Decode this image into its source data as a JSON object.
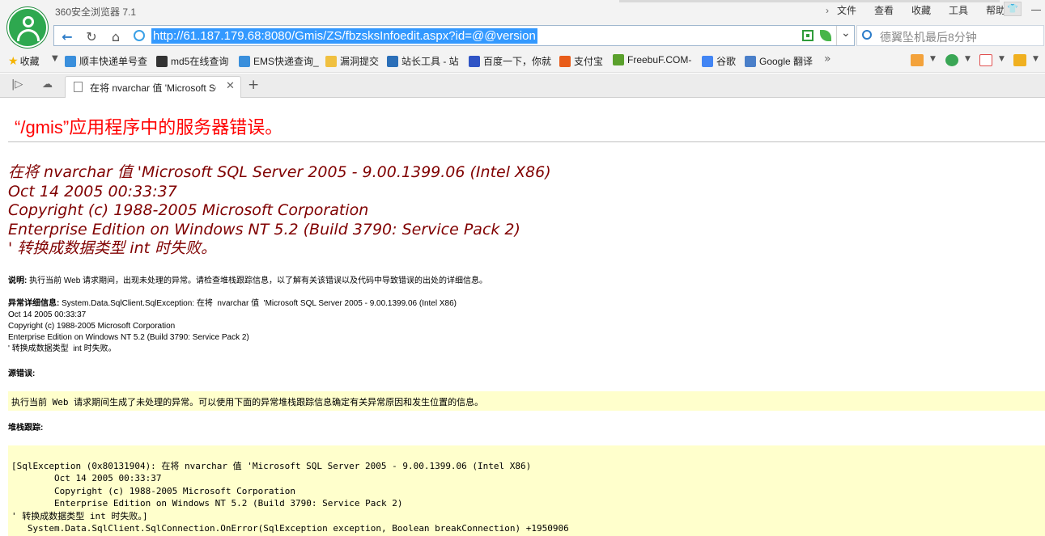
{
  "window": {
    "title": "360安全浏览器 7.1",
    "menus": [
      "文件",
      "查看",
      "收藏",
      "工具",
      "帮助"
    ],
    "skin_label": "👕"
  },
  "nav": {
    "url": "http://61.187.179.68:8080/Gmis/ZS/fbzsksInfoedit.aspx?id=@@version",
    "search_placeholder": "德翼坠机最后8分钟"
  },
  "bookmarks": {
    "favorites_label": "收藏",
    "items": [
      {
        "label": "顺丰快递单号查",
        "icon": "ie-icon",
        "color": "#3a8fdc"
      },
      {
        "label": "md5在线查询",
        "icon": "grid-icon",
        "color": "#333333"
      },
      {
        "label": "EMS快递查询_",
        "icon": "ie-icon",
        "color": "#3a8fdc"
      },
      {
        "label": "漏洞提交",
        "icon": "folder-icon",
        "color": "#f0c040"
      },
      {
        "label": "站长工具 - 站",
        "icon": "chart-icon",
        "color": "#2b6fb8"
      },
      {
        "label": "百度一下，你就",
        "icon": "baidu-paw-icon",
        "color": "#2f54c5"
      },
      {
        "label": "支付宝",
        "icon": "shield-icon",
        "color": "#e85c1a"
      },
      {
        "label": "FreebuF.COM-",
        "icon": "freebuf-icon",
        "color": "#5aa02c"
      },
      {
        "label": "谷歌",
        "icon": "google-icon",
        "color": "#4285f4"
      },
      {
        "label": "Google 翻译",
        "icon": "translate-icon",
        "color": "#4a7fc9"
      }
    ]
  },
  "tabs": [
    {
      "label": "在将 nvarchar 值 'Microsoft SQL Server 2005",
      "active": true
    }
  ],
  "page": {
    "title": "“/gmis”应用程序中的服务器错误。",
    "error_message": "在将 nvarchar 值 'Microsoft SQL Server 2005 - 9.00.1399.06 (Intel X86)\nOct 14 2005 00:33:37\nCopyright (c) 1988-2005 Microsoft Corporation\nEnterprise Edition on Windows NT 5.2 (Build 3790: Service Pack 2)\n' 转换成数据类型 int 时失败。",
    "description_label": "说明:",
    "description_text": " 执行当前 Web 请求期间，出现未处理的异常。请检查堆栈跟踪信息，以了解有关该错误以及代码中导致错误的出处的详细信息。",
    "exception_label": "异常详细信息:",
    "exception_text": " System.Data.SqlClient.SqlException: 在将  nvarchar 值  'Microsoft SQL Server 2005 - 9.00.1399.06 (Intel X86)\nOct 14 2005 00:33:37\nCopyright (c) 1988-2005 Microsoft Corporation\nEnterprise Edition on Windows NT 5.2 (Build 3790: Service Pack 2)\n' 转换成数据类型  int 时失败。",
    "source_error_label": "源错误:",
    "source_error_text": "执行当前 Web 请求期间生成了未处理的异常。可以使用下面的异常堆栈跟踪信息确定有关异常原因和发生位置的信息。",
    "stack_label": "堆栈跟踪:",
    "stack_text": "[SqlException (0x80131904): 在将 nvarchar 值 'Microsoft SQL Server 2005 - 9.00.1399.06 (Intel X86)\n\tOct 14 2005 00:33:37\n\tCopyright (c) 1988-2005 Microsoft Corporation\n\tEnterprise Edition on Windows NT 5.2 (Build 3790: Service Pack 2)\n' 转换成数据类型 int 时失败。]\n   System.Data.SqlClient.SqlConnection.OnError(SqlException exception, Boolean breakConnection) +1950906"
  }
}
